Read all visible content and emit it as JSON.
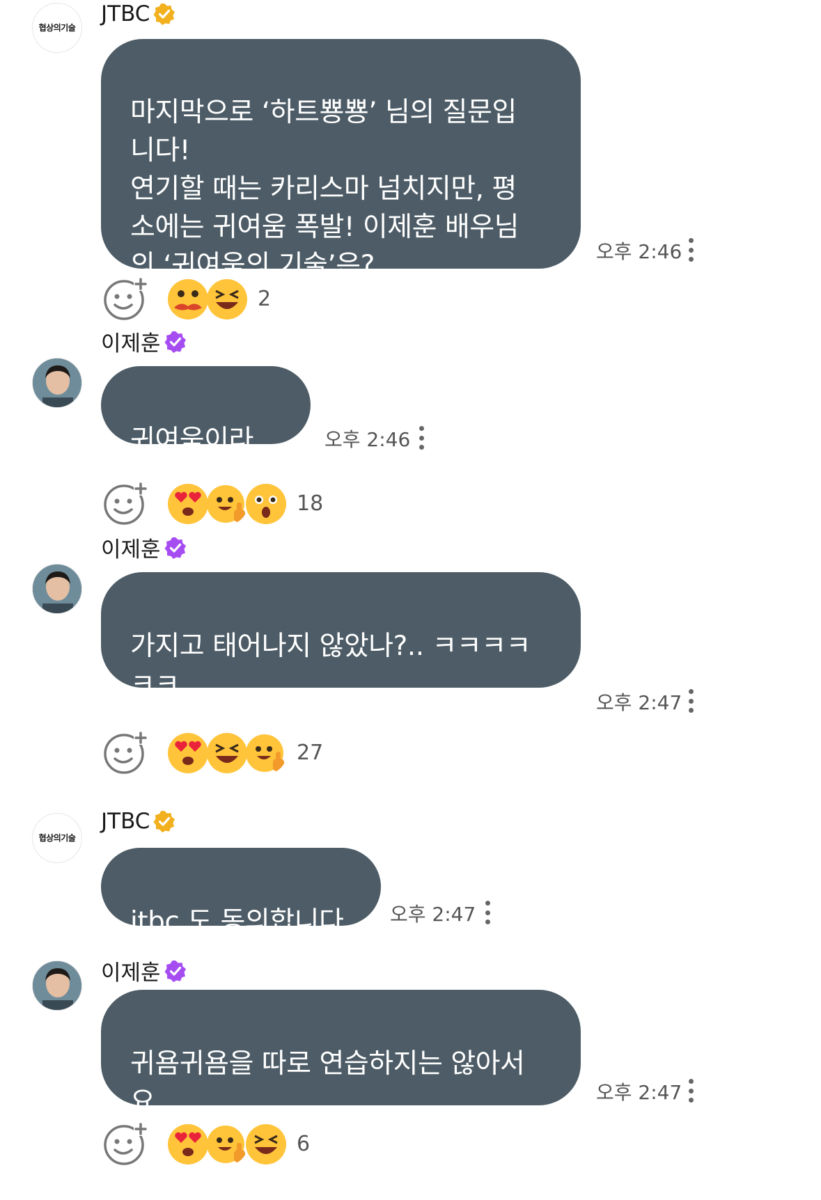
{
  "messages": [
    {
      "sender": "JTBC",
      "avatar": "jtbc-logo",
      "avatar_logo_text": "협상의기술",
      "verified_color": "#f2b01e",
      "text": "마지막으로 ‘하트뿅뿅’ 님의 질문입\n니다!\n연기할 때는 카리스마 넘치지만, 평\n소에는 귀여움 폭발! 이제훈 배우님\n의 ‘귀여움의 기술’은?",
      "time": "오후 2:46",
      "reactions": [
        "mustache-face-emoji",
        "grinning-squint-emoji"
      ],
      "reaction_count": "2"
    },
    {
      "sender": "이제훈",
      "avatar": "person-photo",
      "verified_color": "#a64df2",
      "text": "귀여움이라...",
      "time": "오후 2:46",
      "reactions": [
        "heart-eyes-emoji",
        "thumbs-up-face-emoji",
        "surprised-face-emoji"
      ],
      "reaction_count": "18"
    },
    {
      "sender": "이제훈",
      "avatar": "person-photo",
      "verified_color": "#a64df2",
      "text": "가지고 태어나지 않았나?.. ㅋㅋㅋㅋ\nㅋㅋ",
      "time": "오후 2:47",
      "reactions": [
        "heart-eyes-emoji",
        "grinning-squint-emoji",
        "thumbs-up-face-emoji"
      ],
      "reaction_count": "27"
    },
    {
      "sender": "JTBC",
      "avatar": "jtbc-logo",
      "avatar_logo_text": "협상의기술",
      "verified_color": "#f2b01e",
      "text": "jtbc 도 동의합니다",
      "time": "오후 2:47",
      "reactions": [],
      "reaction_count": ""
    },
    {
      "sender": "이제훈",
      "avatar": "person-photo",
      "verified_color": "#a64df2",
      "text": "귀욤귀욤을 따로 연습하지는 않아서\n요..",
      "time": "오후 2:47",
      "reactions": [
        "heart-eyes-emoji",
        "thumbs-up-face-emoji",
        "grinning-squint-emoji"
      ],
      "reaction_count": "6"
    }
  ],
  "colors": {
    "bubble": "#4d5c66",
    "emoji_yellow": "#ffc43a"
  }
}
